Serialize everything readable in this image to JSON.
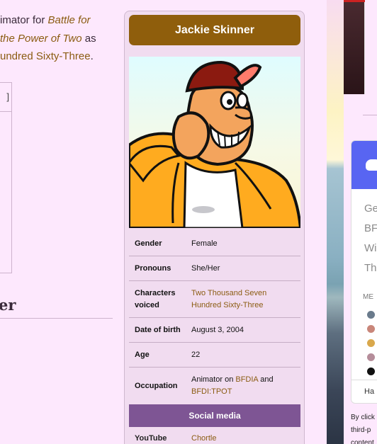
{
  "article": {
    "line1_pre": "imator for ",
    "line1_link": "Battle for",
    "line2_link": "the Power of Two",
    "line2_post": " as",
    "line3_link": "undred Sixty-Three",
    "line3_post": ".",
    "box_bracket": "]",
    "heading_fragment": "er"
  },
  "infobox": {
    "title": "Jackie Skinner",
    "rows": [
      {
        "label": "Gender",
        "value": "Female"
      },
      {
        "label": "Pronouns",
        "value": "She/Her"
      },
      {
        "label": "Characters voiced",
        "value": "Two Thousand Seven Hundred Sixty-Three"
      },
      {
        "label": "Date of birth",
        "value": "August 3, 2004"
      },
      {
        "label": "Age",
        "value": "22"
      },
      {
        "label": "Occupation",
        "value_pre": "Animator on ",
        "value_link1": "BFDIA",
        "value_mid": " and ",
        "value_link2": "BFDI:TPOT"
      }
    ],
    "social_header": "Social media",
    "social_rows": [
      {
        "label": "YouTube",
        "value": "Chortle"
      }
    ]
  },
  "rail": {
    "discord_text": "Ge\nBF\nWi\nTh",
    "members_label": "ME",
    "footer_fragment": "Ha",
    "bottom_text": "By click\nthird-p\ncontent"
  },
  "colors": {
    "page_bg": "#fde8fd",
    "title_bg": "#8f5e0c",
    "social_bg": "#7e5594",
    "link": "#8b5c12",
    "discord": "#5865f2"
  }
}
